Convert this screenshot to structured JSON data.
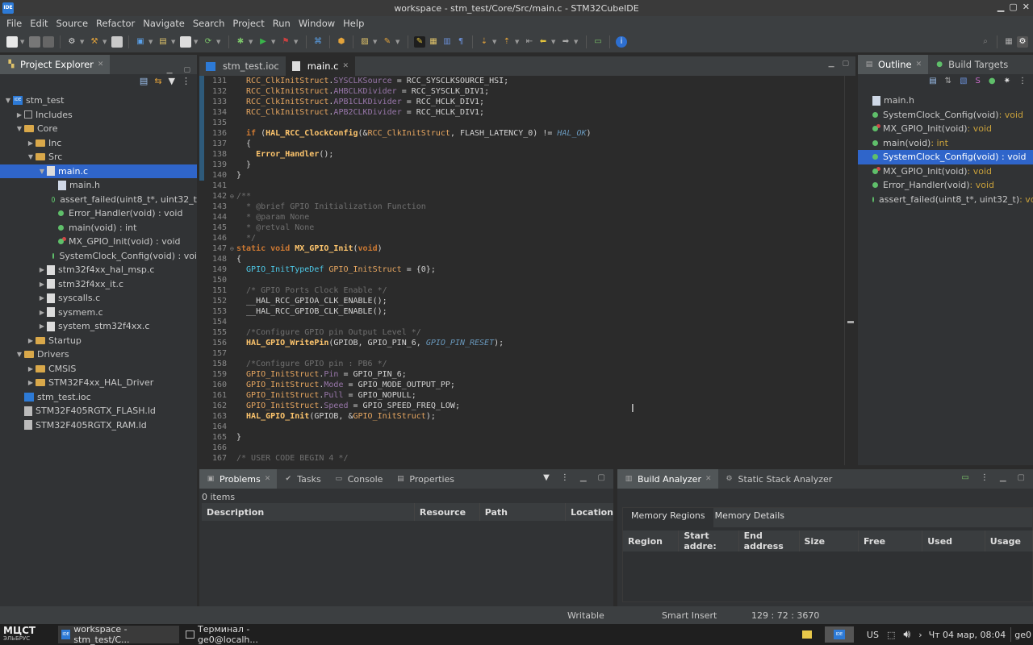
{
  "window": {
    "title": "workspace - stm_test/Core/Src/main.c - STM32CubeIDE",
    "logo": "IDE"
  },
  "menu": [
    "File",
    "Edit",
    "Source",
    "Refactor",
    "Navigate",
    "Search",
    "Project",
    "Run",
    "Window",
    "Help"
  ],
  "project_explorer": {
    "tab": "Project Explorer",
    "items": [
      {
        "indent": 0,
        "arrow": "▼",
        "icon": "project",
        "label": "stm_test"
      },
      {
        "indent": 1,
        "arrow": "▶",
        "icon": "includes",
        "label": "Includes"
      },
      {
        "indent": 1,
        "arrow": "▼",
        "icon": "folder",
        "label": "Core"
      },
      {
        "indent": 2,
        "arrow": "▶",
        "icon": "folder",
        "label": "Inc"
      },
      {
        "indent": 2,
        "arrow": "▼",
        "icon": "folder",
        "label": "Src"
      },
      {
        "indent": 3,
        "arrow": "▼",
        "icon": "cfile",
        "label": "main.c",
        "selected": true
      },
      {
        "indent": 4,
        "arrow": "",
        "icon": "hfile",
        "label": "main.h"
      },
      {
        "indent": 4,
        "arrow": "",
        "icon": "dot-strike",
        "label": "assert_failed(uint8_t*, uint32_t"
      },
      {
        "indent": 4,
        "arrow": "",
        "icon": "dot",
        "label": "Error_Handler(void) : void"
      },
      {
        "indent": 4,
        "arrow": "",
        "icon": "dot",
        "label": "main(void) : int"
      },
      {
        "indent": 4,
        "arrow": "",
        "icon": "dot-s",
        "label": "MX_GPIO_Init(void) : void"
      },
      {
        "indent": 4,
        "arrow": "",
        "icon": "dot",
        "label": "SystemClock_Config(void) : voi"
      },
      {
        "indent": 3,
        "arrow": "▶",
        "icon": "cfile",
        "label": "stm32f4xx_hal_msp.c"
      },
      {
        "indent": 3,
        "arrow": "▶",
        "icon": "cfile",
        "label": "stm32f4xx_it.c"
      },
      {
        "indent": 3,
        "arrow": "▶",
        "icon": "cfile",
        "label": "syscalls.c"
      },
      {
        "indent": 3,
        "arrow": "▶",
        "icon": "cfile",
        "label": "sysmem.c"
      },
      {
        "indent": 3,
        "arrow": "▶",
        "icon": "cfile",
        "label": "system_stm32f4xx.c"
      },
      {
        "indent": 2,
        "arrow": "▶",
        "icon": "folder",
        "label": "Startup"
      },
      {
        "indent": 1,
        "arrow": "▼",
        "icon": "folder",
        "label": "Drivers"
      },
      {
        "indent": 2,
        "arrow": "▶",
        "icon": "folder",
        "label": "CMSIS"
      },
      {
        "indent": 2,
        "arrow": "▶",
        "icon": "folder",
        "label": "STM32F4xx_HAL_Driver"
      },
      {
        "indent": 1,
        "arrow": "",
        "icon": "ioc",
        "label": "stm_test.ioc"
      },
      {
        "indent": 1,
        "arrow": "",
        "icon": "ld",
        "label": "STM32F405RGTX_FLASH.ld"
      },
      {
        "indent": 1,
        "arrow": "",
        "icon": "ld",
        "label": "STM32F405RGTX_RAM.ld"
      }
    ]
  },
  "editor": {
    "tabs": [
      {
        "label": "stm_test.ioc",
        "active": false
      },
      {
        "label": "main.c",
        "active": true
      }
    ],
    "lines": [
      {
        "n": "131",
        "t": [
          [
            "var",
            "  RCC_ClkInitStruct"
          ],
          [
            "txt",
            "."
          ],
          [
            "fld",
            "SYSCLKSource"
          ],
          [
            "txt",
            " = RCC_SYSCLKSOURCE_HSI;"
          ]
        ]
      },
      {
        "n": "132",
        "t": [
          [
            "var",
            "  RCC_ClkInitStruct"
          ],
          [
            "txt",
            "."
          ],
          [
            "fld",
            "AHBCLKDivider"
          ],
          [
            "txt",
            " = RCC_SYSCLK_DIV1;"
          ]
        ]
      },
      {
        "n": "133",
        "t": [
          [
            "var",
            "  RCC_ClkInitStruct"
          ],
          [
            "txt",
            "."
          ],
          [
            "fld",
            "APB1CLKDivider"
          ],
          [
            "txt",
            " = RCC_HCLK_DIV1;"
          ]
        ]
      },
      {
        "n": "134",
        "t": [
          [
            "var",
            "  RCC_ClkInitStruct"
          ],
          [
            "txt",
            "."
          ],
          [
            "fld",
            "APB2CLKDivider"
          ],
          [
            "txt",
            " = RCC_HCLK_DIV1;"
          ]
        ]
      },
      {
        "n": "135",
        "t": []
      },
      {
        "n": "136",
        "t": [
          [
            "kw",
            "  if"
          ],
          [
            "txt",
            " ("
          ],
          [
            "fn",
            "HAL_RCC_ClockConfig"
          ],
          [
            "txt",
            "(&"
          ],
          [
            "var",
            "RCC_ClkInitStruct"
          ],
          [
            "txt",
            ", FLASH_LATENCY_0) != "
          ],
          [
            "it",
            "HAL_OK"
          ],
          [
            "txt",
            ")"
          ]
        ]
      },
      {
        "n": "137",
        "t": [
          [
            "txt",
            "  {"
          ]
        ]
      },
      {
        "n": "138",
        "t": [
          [
            "fn",
            "    Error_Handler"
          ],
          [
            "txt",
            "();"
          ]
        ]
      },
      {
        "n": "139",
        "t": [
          [
            "txt",
            "  }"
          ]
        ]
      },
      {
        "n": "140",
        "t": [
          [
            "txt",
            "}"
          ]
        ]
      },
      {
        "n": "141",
        "t": []
      },
      {
        "n": "142",
        "t": [
          [
            "cm",
            "/**"
          ]
        ]
      },
      {
        "n": "143",
        "t": [
          [
            "cm",
            "  * @brief GPIO Initialization Function"
          ]
        ]
      },
      {
        "n": "144",
        "t": [
          [
            "cm",
            "  * @param None"
          ]
        ]
      },
      {
        "n": "145",
        "t": [
          [
            "cm",
            "  * @retval None"
          ]
        ]
      },
      {
        "n": "146",
        "t": [
          [
            "cm",
            "  */"
          ]
        ]
      },
      {
        "n": "147",
        "t": [
          [
            "kw",
            "static void "
          ],
          [
            "fn",
            "MX_GPIO_Init"
          ],
          [
            "txt",
            "("
          ],
          [
            "kw",
            "void"
          ],
          [
            "txt",
            ")"
          ]
        ]
      },
      {
        "n": "148",
        "t": [
          [
            "txt",
            "{"
          ]
        ]
      },
      {
        "n": "149",
        "t": [
          [
            "ty",
            "  GPIO_InitTypeDef "
          ],
          [
            "var",
            "GPIO_InitStruct"
          ],
          [
            "txt",
            " = {0};"
          ]
        ]
      },
      {
        "n": "150",
        "t": []
      },
      {
        "n": "151",
        "t": [
          [
            "cm",
            "  /* GPIO Ports Clock Enable */"
          ]
        ]
      },
      {
        "n": "152",
        "t": [
          [
            "txt",
            "  __HAL_RCC_GPIOA_CLK_ENABLE();"
          ]
        ]
      },
      {
        "n": "153",
        "t": [
          [
            "txt",
            "  __HAL_RCC_GPIOB_CLK_ENABLE();"
          ]
        ]
      },
      {
        "n": "154",
        "t": []
      },
      {
        "n": "155",
        "t": [
          [
            "cm",
            "  /*Configure GPIO pin Output Level */"
          ]
        ]
      },
      {
        "n": "156",
        "t": [
          [
            "fn",
            "  HAL_GPIO_WritePin"
          ],
          [
            "txt",
            "(GPIOB, GPIO_PIN_6, "
          ],
          [
            "it",
            "GPIO_PIN_RESET"
          ],
          [
            "txt",
            ");"
          ]
        ]
      },
      {
        "n": "157",
        "t": []
      },
      {
        "n": "158",
        "t": [
          [
            "cm",
            "  /*Configure GPIO pin : PB6 */"
          ]
        ]
      },
      {
        "n": "159",
        "t": [
          [
            "var",
            "  GPIO_InitStruct"
          ],
          [
            "txt",
            "."
          ],
          [
            "fld",
            "Pin"
          ],
          [
            "txt",
            " = GPIO_PIN_6;"
          ]
        ]
      },
      {
        "n": "160",
        "t": [
          [
            "var",
            "  GPIO_InitStruct"
          ],
          [
            "txt",
            "."
          ],
          [
            "fld",
            "Mode"
          ],
          [
            "txt",
            " = GPIO_MODE_OUTPUT_PP;"
          ]
        ]
      },
      {
        "n": "161",
        "t": [
          [
            "var",
            "  GPIO_InitStruct"
          ],
          [
            "txt",
            "."
          ],
          [
            "fld",
            "Pull"
          ],
          [
            "txt",
            " = GPIO_NOPULL;"
          ]
        ]
      },
      {
        "n": "162",
        "t": [
          [
            "var",
            "  GPIO_InitStruct"
          ],
          [
            "txt",
            "."
          ],
          [
            "fld",
            "Speed"
          ],
          [
            "txt",
            " = GPIO_SPEED_FREQ_LOW;"
          ]
        ]
      },
      {
        "n": "163",
        "t": [
          [
            "fn",
            "  HAL_GPIO_Init"
          ],
          [
            "txt",
            "(GPIOB, &"
          ],
          [
            "var",
            "GPIO_InitStruct"
          ],
          [
            "txt",
            ");"
          ]
        ]
      },
      {
        "n": "164",
        "t": []
      },
      {
        "n": "165",
        "t": [
          [
            "txt",
            "}"
          ]
        ]
      },
      {
        "n": "166",
        "t": []
      },
      {
        "n": "167",
        "t": [
          [
            "cm",
            "/* USER CODE BEGIN 4 */"
          ]
        ]
      },
      {
        "n": "168",
        "t": []
      }
    ]
  },
  "outline": {
    "tabs": [
      "Outline",
      "Build Targets"
    ],
    "items": [
      {
        "icon": "hfile",
        "label": "main.h",
        "type": ""
      },
      {
        "icon": "dot",
        "label": "SystemClock_Config(void)",
        "type": " : void"
      },
      {
        "icon": "dot-s",
        "label": "MX_GPIO_Init(void)",
        "type": " : void"
      },
      {
        "icon": "dot",
        "label": "main(void)",
        "type": " : int"
      },
      {
        "icon": "dot",
        "label": "SystemClock_Config(void) : void",
        "type": "",
        "selected": true
      },
      {
        "icon": "dot-s",
        "label": "MX_GPIO_Init(void)",
        "type": " : void"
      },
      {
        "icon": "dot",
        "label": "Error_Handler(void)",
        "type": " : void"
      },
      {
        "icon": "dot-strike",
        "label": "assert_failed(uint8_t*, uint32_t)",
        "type": " : vo"
      }
    ]
  },
  "problems": {
    "tabs": [
      "Problems",
      "Tasks",
      "Console",
      "Properties"
    ],
    "count": "0 items",
    "columns": [
      "Description",
      "Resource",
      "Path",
      "Location"
    ]
  },
  "build_analyzer": {
    "tabs": [
      "Build Analyzer",
      "Static Stack Analyzer"
    ],
    "subtabs": [
      "Memory Regions",
      "Memory Details"
    ],
    "columns": [
      "Region",
      "Start addre:",
      "End address",
      "Size",
      "Free",
      "Used",
      "Usage"
    ]
  },
  "status": {
    "writable": "Writable",
    "insert": "Smart Insert",
    "position": "129 : 72 : 3670"
  },
  "taskbar": {
    "brand": "МЦСТ",
    "brand_sub": "ЭЛЬБРУС",
    "tasks": [
      "workspace - stm_test/C...",
      "Терминал - ge0@localh..."
    ],
    "lang": "US",
    "clock": "Чт 04 мар, 08:04",
    "user": "ge0"
  }
}
